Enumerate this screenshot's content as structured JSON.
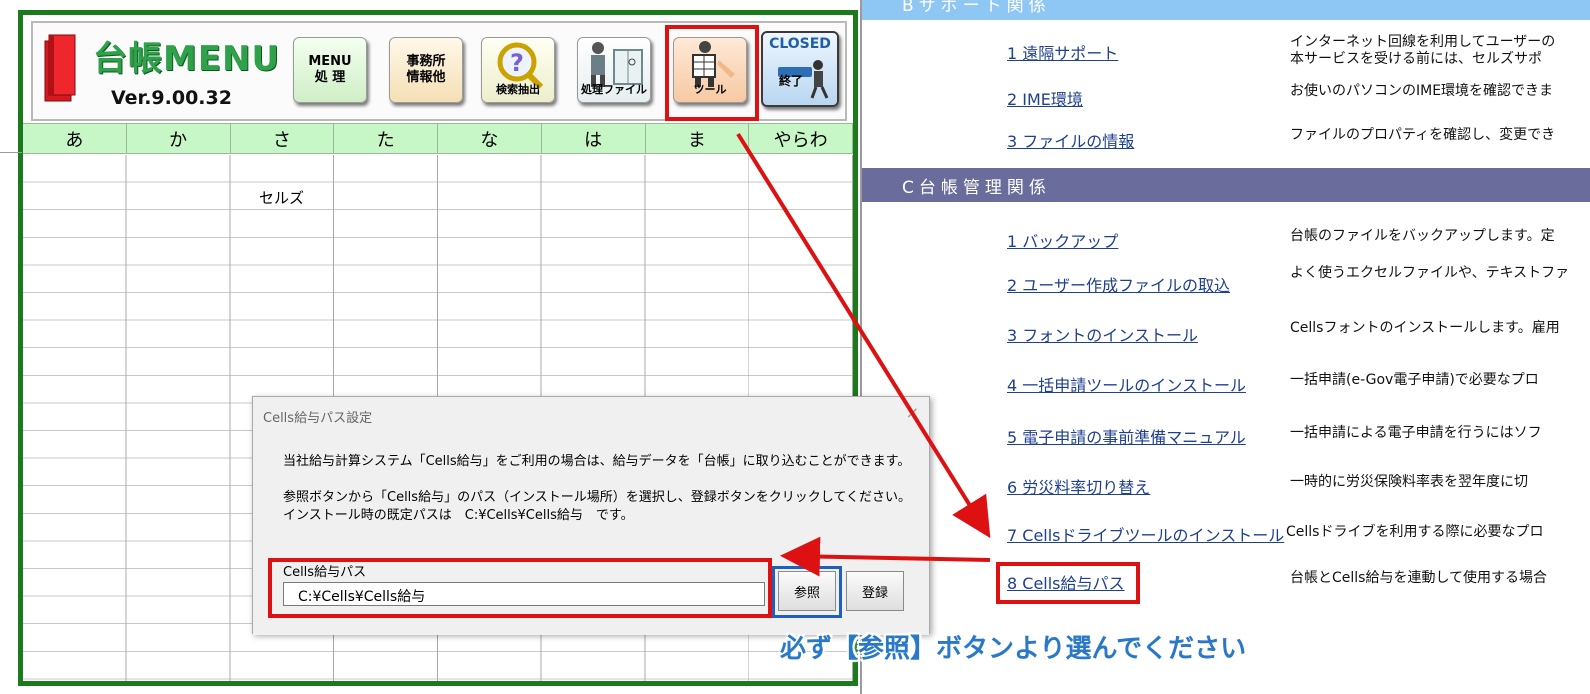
{
  "menu": {
    "logo_title": "台帳MENU",
    "version": "Ver.9.00.32",
    "buttons": {
      "menu_line1": "MENU",
      "menu_line2": "処 理",
      "office_line1": "事務所",
      "office_line2": "情報他",
      "search": "検索抽出",
      "files": "処理ファイル",
      "tools": "ツール",
      "closed_top": "CLOSED",
      "closed_label": "終了"
    }
  },
  "kana_columns": [
    "あ",
    "か",
    "さ",
    "た",
    "な",
    "は",
    "ま",
    "やらわ"
  ],
  "grid": {
    "cell_sa_1": "セルズ"
  },
  "dialog": {
    "title": "Cells給与パス設定",
    "close": "×",
    "line1": "当社給与計算システム「Cells給与」をご利用の場合は、給与データを「台帳」に取り込むことができます。",
    "line2": "参照ボタンから「Cells給与」のパス（インストール場所）を選択し、登録ボタンをクリックしてください。",
    "line3": "インストール時の既定パスは　C:¥Cells¥Cells給与　です。",
    "path_label": "Cells給与パス",
    "path_value": "C:¥Cells¥Cells給与",
    "browse_button": "参照",
    "register_button": "登録"
  },
  "right": {
    "section_b": "Bサポート関係",
    "section_c": "C台帳管理関係",
    "b_items": [
      {
        "link": "1 遠隔サポート",
        "desc": "インターネット回線を利用してユーザーの",
        "desc2": "本サービスを受ける前には、セルズサポ"
      },
      {
        "link": "2 IME環境",
        "desc": "お使いのパソコンのIME環境を確認できま"
      },
      {
        "link": "3 ファイルの情報",
        "desc": "ファイルのプロパティを確認し、変更でき"
      }
    ],
    "c_items": [
      {
        "link": "1 バックアップ",
        "desc": "台帳のファイルをバックアップします。定"
      },
      {
        "link": "2 ユーザー作成ファイルの取込",
        "desc": "よく使うエクセルファイルや、テキストファ"
      },
      {
        "link": "3 フォントのインストール",
        "desc": "Cellsフォントのインストールします。雇用"
      },
      {
        "link": "4 一括申請ツールのインストール",
        "desc": "一括申請(e-Gov電子申請)で必要なプロ"
      },
      {
        "link": "5 電子申請の事前準備マニュアル",
        "desc": "一括申請による電子申請を行うにはソフ"
      },
      {
        "link": "6 労災料率切り替え",
        "desc": "一時的に労災保険料率表を翌年度に切"
      },
      {
        "link": "7 Cellsドライブツールのインストール",
        "desc": "Cellsドライブを利用する際に必要なプロ"
      },
      {
        "link": "8 Cells給与パス",
        "desc": "台帳とCells給与を連動して使用する場合"
      }
    ]
  },
  "callout": "必ず【参照】ボタンより選んでください",
  "colors": {
    "highlight_red": "#dd1111",
    "highlight_blue": "#1f5fbf",
    "panel_green": "#1b7a1b",
    "kana_bg": "#c7f7c7",
    "section_b_bg": "#8ec6f4",
    "section_c_bg": "#6a6c9c",
    "link_blue": "#1f3f8f"
  }
}
